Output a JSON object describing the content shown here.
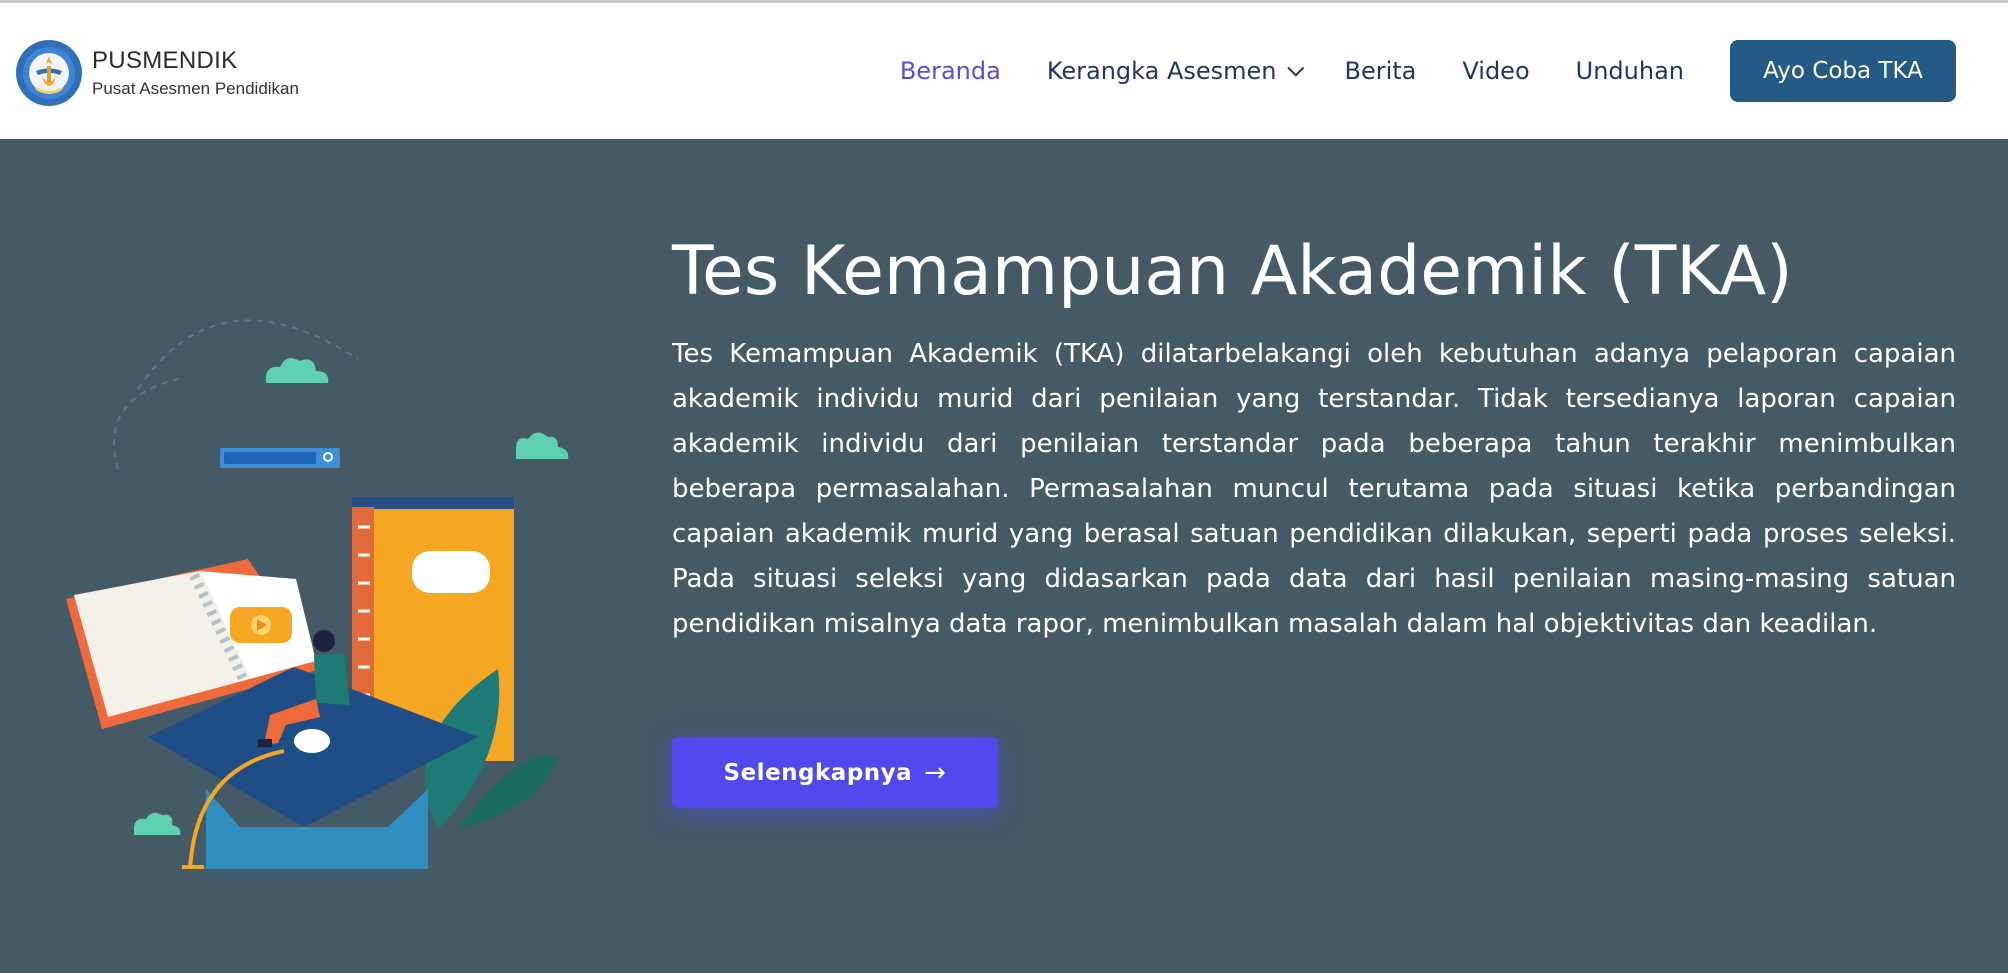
{
  "brand": {
    "name": "PUSMENDIK",
    "subtitle": "Pusat Asesmen Pendidikan"
  },
  "nav": {
    "items": [
      {
        "label": "Beranda",
        "active": true
      },
      {
        "label": "Kerangka Asesmen",
        "active": false,
        "has_dropdown": true
      },
      {
        "label": "Berita",
        "active": false
      },
      {
        "label": "Video",
        "active": false
      },
      {
        "label": "Unduhan",
        "active": false
      }
    ],
    "cta_label": "Ayo Coba TKA"
  },
  "hero": {
    "title": "Tes Kemampuan Akademik (TKA)",
    "description": "Tes Kemampuan Akademik (TKA) dilatarbelakangi oleh kebutuhan adanya pelaporan capaian akademik individu murid dari penilaian yang terstandar. Tidak tersedianya laporan capaian akademik individu dari penilaian terstandar pada beberapa tahun terakhir menimbulkan beberapa permasalahan. Permasalahan muncul terutama pada situasi ketika perbandingan capaian akademik murid yang berasal satuan pendidikan dilakukan, seperti pada proses seleksi. Pada situasi seleksi yang didasarkan pada data dari hasil penilaian masing-masing satuan pendidikan misalnya data rapor, menimbulkan masalah dalam hal objektivitas dan keadilan.",
    "button_label": "Selengkapnya",
    "button_icon": "→"
  },
  "colors": {
    "hero_bg": "#445a67",
    "nav_text": "#25356b",
    "nav_active": "#5a4fd6",
    "cta_bg": "#245a86",
    "hero_button_bg": "#5148ee"
  }
}
